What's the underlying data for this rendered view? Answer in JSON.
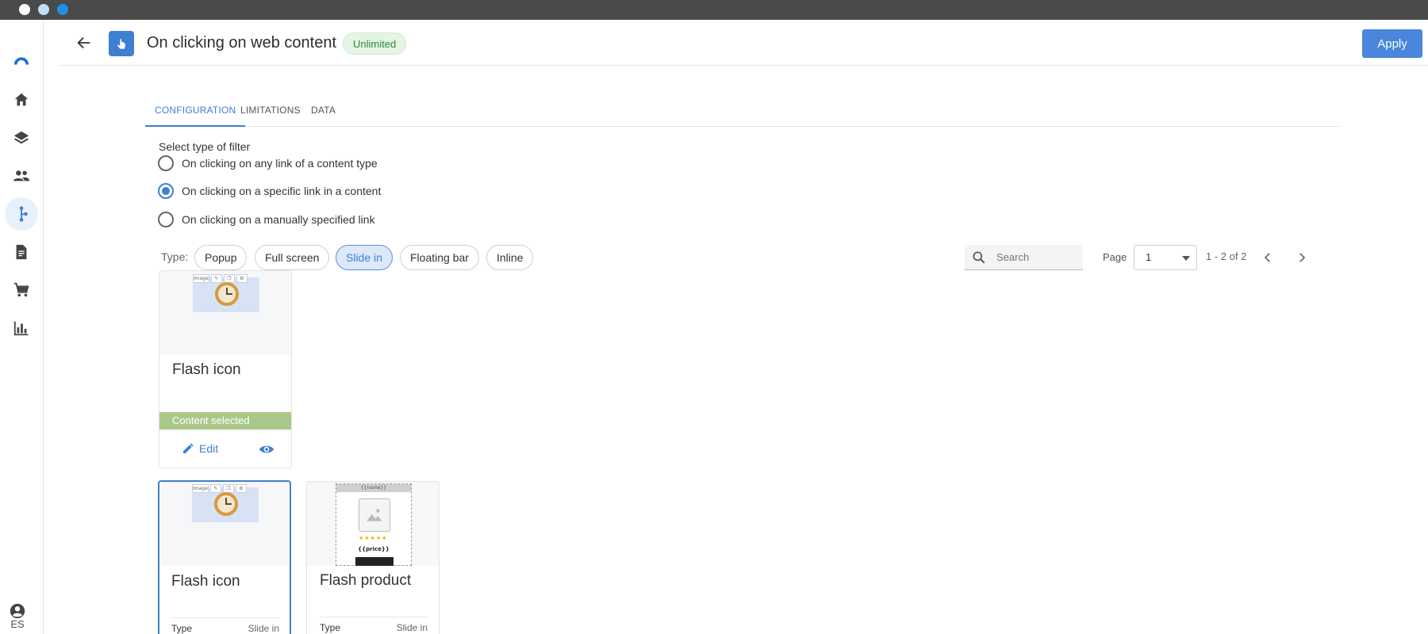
{
  "header": {
    "title": "On clicking on web content",
    "badge": "Unlimited",
    "apply_label": "Apply"
  },
  "sidebar": {
    "items": [
      {
        "name": "logo-icon"
      },
      {
        "name": "home-icon"
      },
      {
        "name": "layers-icon"
      },
      {
        "name": "people-icon"
      },
      {
        "name": "flow-icon",
        "active": true
      },
      {
        "name": "document-icon"
      },
      {
        "name": "cart-icon"
      },
      {
        "name": "chart-icon"
      }
    ],
    "lang": "ES"
  },
  "tabs": [
    {
      "label": "CONFIGURATION",
      "active": true
    },
    {
      "label": "LIMITATIONS"
    },
    {
      "label": "DATA"
    }
  ],
  "filter": {
    "label": "Select type of filter",
    "options": [
      {
        "label": "On clicking on any link of a content type",
        "checked": false
      },
      {
        "label": "On clicking on a specific link in a content",
        "checked": true
      },
      {
        "label": "On clicking on a manually specified link",
        "checked": false
      }
    ]
  },
  "types": {
    "label": "Type:",
    "chips": [
      {
        "label": "Popup"
      },
      {
        "label": "Full screen"
      },
      {
        "label": "Slide in",
        "active": true
      },
      {
        "label": "Floating bar"
      },
      {
        "label": "Inline"
      }
    ]
  },
  "search": {
    "placeholder": "Search"
  },
  "paging": {
    "page_label": "Page",
    "page_value": "1",
    "range": "1 - 2 of 2"
  },
  "selected_card": {
    "title": "Flash icon",
    "status": "Content selected",
    "edit_label": "Edit",
    "preview": {
      "tag": "Image"
    }
  },
  "cards": [
    {
      "title": "Flash icon",
      "type_key": "Type",
      "type_value": "Slide in",
      "selected": true,
      "preview": {
        "tag": "Image"
      }
    },
    {
      "title": "Flash product",
      "type_key": "Type",
      "type_value": "Slide in",
      "selected": false,
      "preview": {
        "head": "{{name}}",
        "stars": "★★★★★",
        "price": "{{price}}"
      }
    }
  ],
  "colors": {
    "accent": "#3f7fd0",
    "apply": "#4a86db",
    "badge_bg": "#e4f5e4",
    "selected_band": "#a9c88a"
  }
}
